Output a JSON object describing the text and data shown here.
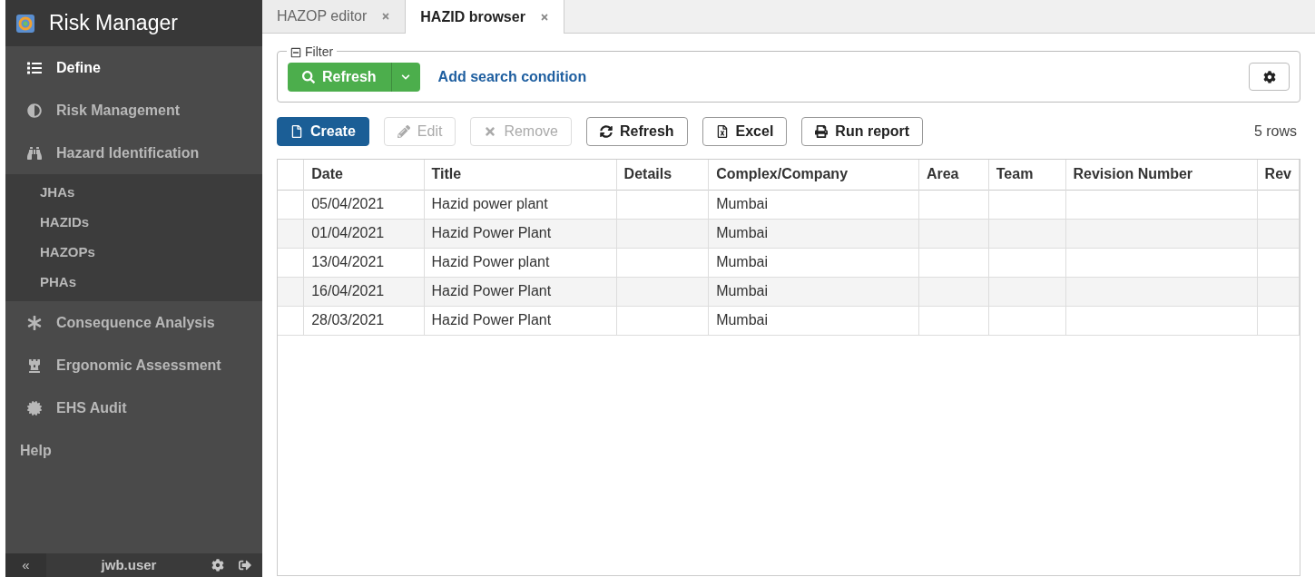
{
  "app_title": "Risk Manager",
  "sidebar": {
    "items": [
      {
        "label": "Define",
        "selected": true
      },
      {
        "label": "Risk Management",
        "selected": false
      },
      {
        "label": "Hazard Identification",
        "selected": false,
        "children": [
          {
            "label": "JHAs",
            "selected": false
          },
          {
            "label": "HAZIDs",
            "selected": false
          },
          {
            "label": "HAZOPs",
            "selected": false
          },
          {
            "label": "PHAs",
            "selected": false
          }
        ]
      },
      {
        "label": "Consequence Analysis",
        "selected": false
      },
      {
        "label": "Ergonomic Assessment",
        "selected": false
      },
      {
        "label": "EHS Audit",
        "selected": false
      },
      {
        "label": "Help",
        "selected": false
      }
    ],
    "footer": {
      "collapse": "«",
      "user": "jwb.user"
    }
  },
  "tabs": [
    {
      "label": "HAZOP editor",
      "selected": false
    },
    {
      "label": "HAZID browser",
      "selected": true
    }
  ],
  "filter": {
    "legend": "Filter",
    "refresh": "Refresh",
    "add_condition": "Add search condition"
  },
  "toolbar": {
    "buttons": [
      {
        "label": "Create",
        "kind": "primary",
        "disabled": false
      },
      {
        "label": "Edit",
        "kind": "default",
        "disabled": true
      },
      {
        "label": "Remove",
        "kind": "default",
        "disabled": true
      },
      {
        "label": "Refresh",
        "kind": "default",
        "disabled": false
      },
      {
        "label": "Excel",
        "kind": "default",
        "disabled": false
      },
      {
        "label": "Run report",
        "kind": "default",
        "disabled": false
      }
    ],
    "row_count": "5 rows"
  },
  "table": {
    "columns": [
      "Date",
      "Title",
      "Details",
      "Complex/Company",
      "Area",
      "Team",
      "Revision Number",
      "Rev"
    ],
    "rows": [
      [
        "05/04/2021",
        "Hazid power plant",
        "",
        "Mumbai",
        "",
        "",
        "",
        ""
      ],
      [
        "01/04/2021",
        "Hazid Power Plant",
        "",
        "Mumbai",
        "",
        "",
        "",
        ""
      ],
      [
        "13/04/2021",
        "Hazid Power plant",
        "",
        "Mumbai",
        "",
        "",
        "",
        ""
      ],
      [
        "16/04/2021",
        "Hazid Power Plant",
        "",
        "Mumbai",
        "",
        "",
        "",
        ""
      ],
      [
        "28/03/2021",
        "Hazid Power Plant",
        "",
        "Mumbai",
        "",
        "",
        "",
        ""
      ]
    ]
  }
}
